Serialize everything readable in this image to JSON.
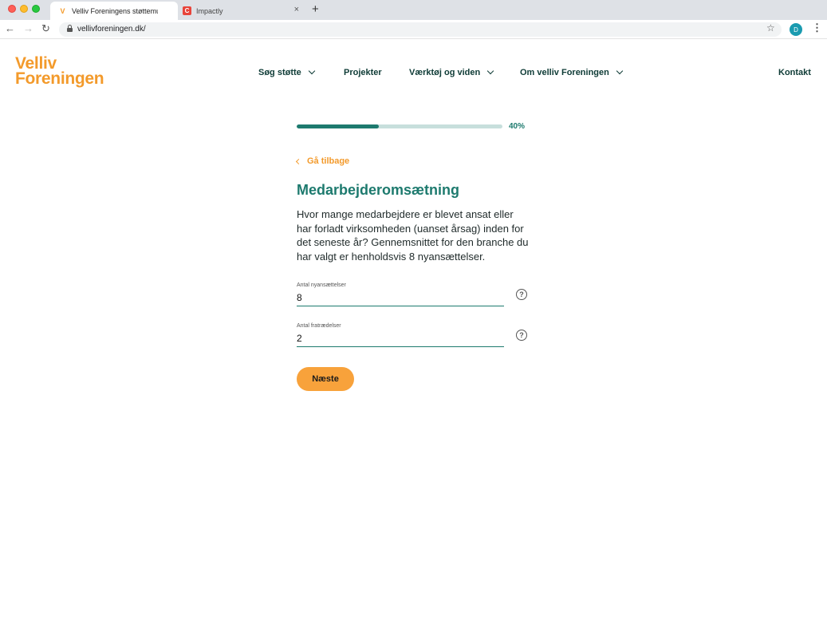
{
  "browser": {
    "tabs": [
      {
        "title": "Velliv Foreningens støttemulighe",
        "favicon": "velliv-v-icon",
        "active": true
      },
      {
        "title": "Impactly",
        "favicon": "impactly-icon",
        "active": false
      }
    ],
    "close_glyph": "×",
    "new_tab_glyph": "+",
    "url": "vellivforeningen.dk/",
    "profile_initial": "D"
  },
  "site": {
    "logo": {
      "line1": "Velliv",
      "line2": "Foreningen",
      "color": "#f39a2b"
    },
    "nav": [
      {
        "label": "Søg støtte",
        "has_dropdown": true
      },
      {
        "label": "Projekter",
        "has_dropdown": false
      },
      {
        "label": "Værktøj og viden",
        "has_dropdown": true
      },
      {
        "label": "Om velliv Foreningen",
        "has_dropdown": true
      },
      {
        "label": "Kontakt",
        "has_dropdown": false
      }
    ]
  },
  "form": {
    "progress": {
      "percent": 40,
      "label": "40%"
    },
    "back_label": "Gå tilbage",
    "title": "Medarbejderomsætning",
    "description": "Hvor mange medarbejdere er blevet ansat eller har forladt virksomheden (uanset årsag) inden for det seneste år? Gennemsnittet for den branche du har valgt er henholdsvis 8 nyansættelser.",
    "fields": [
      {
        "label": "Antal nyansættelser",
        "value": "8"
      },
      {
        "label": "Antal fratrædelser",
        "value": "2"
      }
    ],
    "help_glyph": "?",
    "next_label": "Næste"
  },
  "colors": {
    "accent": "#1d7a6e",
    "brand_orange": "#f39a2b",
    "button": "#f8a23b",
    "nav_text": "#0e3b36"
  }
}
